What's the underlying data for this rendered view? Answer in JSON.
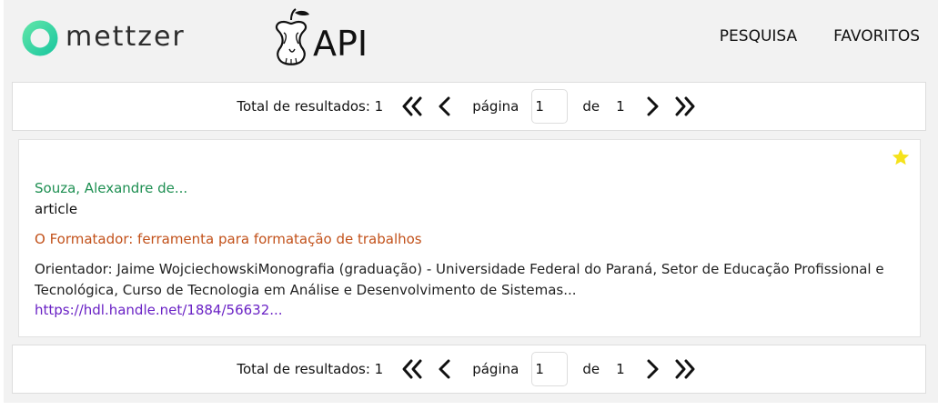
{
  "header": {
    "brand_name": "mettzer",
    "api_label": "API",
    "nav": [
      "PESQUISA",
      "FAVORITOS"
    ]
  },
  "pager": {
    "total_label": "Total de resultados: 1",
    "page_label": "página",
    "current_page": "1",
    "of_label": "de",
    "total_pages": "1"
  },
  "result": {
    "author": "Souza, Alexandre de...",
    "type": "article",
    "title": "O Formatador: ferramenta para formatação de trabalhos",
    "description": "Orientador: Jaime WojciechowskiMonografia (graduação) - Universidade Federal do Paraná, Setor de Educação Profissional e Tecnológica, Curso de Tecnologia em Análise e Desenvolvimento de Sistemas...",
    "link": "https://hdl.handle.net/1884/56632...",
    "favorited": true
  },
  "colors": {
    "brand_green": "#2ed39a",
    "author": "#1e8f52",
    "title": "#c2511a",
    "link": "#6a22c5",
    "star": "#f5e21b"
  },
  "icons": [
    "mettzer-logo-icon",
    "apple-core-icon",
    "double-chevron-left-icon",
    "chevron-left-icon",
    "chevron-right-icon",
    "double-chevron-right-icon",
    "star-icon"
  ]
}
